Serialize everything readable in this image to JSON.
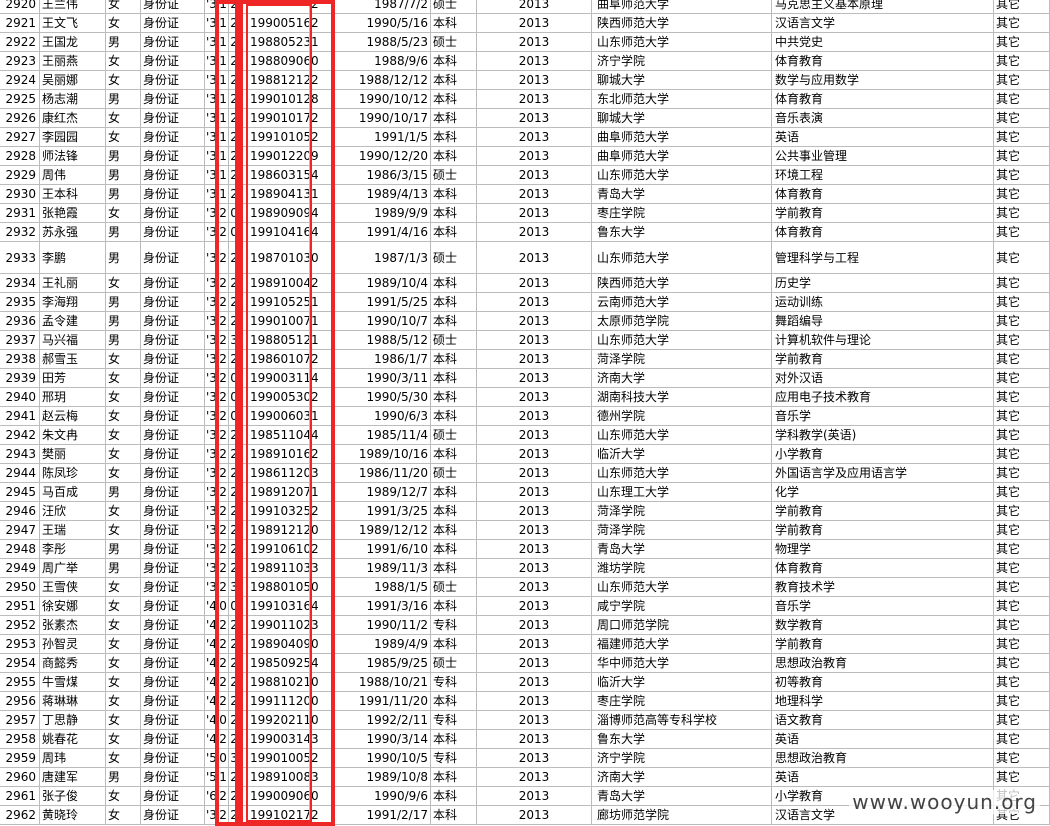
{
  "columns": [
    "no",
    "name",
    "gender",
    "id_type",
    "id1",
    "id2",
    "id3",
    "birth_code",
    "id_tail",
    "birth_date",
    "degree",
    "year",
    "school",
    "major",
    "category"
  ],
  "rows": [
    [
      "2920",
      "王兰伟",
      "女",
      "身份证",
      "'3",
      "1",
      "2",
      "",
      "2",
      "1987/7/2",
      "硕士",
      "2013",
      "曲阜师范大学",
      "马克思主义基本原理",
      "其它"
    ],
    [
      "2921",
      "王文飞",
      "女",
      "身份证",
      "'3",
      "1",
      "2",
      "19900516",
      "2",
      "1990/5/16",
      "本科",
      "2013",
      "陕西师范大学",
      "汉语言文学",
      "其它"
    ],
    [
      "2922",
      "王国龙",
      "男",
      "身份证",
      "'3",
      "1",
      "2",
      "19880523",
      "1",
      "1988/5/23",
      "硕士",
      "2013",
      "山东师范大学",
      "中共党史",
      "其它"
    ],
    [
      "2923",
      "王丽燕",
      "女",
      "身份证",
      "'3",
      "1",
      "2",
      "19880906",
      "0",
      "1988/9/6",
      "本科",
      "2013",
      "济宁学院",
      "体育教育",
      "其它"
    ],
    [
      "2924",
      "吴丽娜",
      "女",
      "身份证",
      "'3",
      "1",
      "2",
      "19881212",
      "2",
      "1988/12/12",
      "本科",
      "2013",
      "聊城大学",
      "数学与应用数学",
      "其它"
    ],
    [
      "2925",
      "杨志潮",
      "男",
      "身份证",
      "'3",
      "1",
      "2",
      "19901012",
      "8",
      "1990/10/12",
      "本科",
      "2013",
      "东北师范大学",
      "体育教育",
      "其它"
    ],
    [
      "2926",
      "康红杰",
      "女",
      "身份证",
      "'3",
      "1",
      "2",
      "19901017",
      "2",
      "1990/10/17",
      "本科",
      "2013",
      "聊城大学",
      "音乐表演",
      "其它"
    ],
    [
      "2927",
      "李园园",
      "女",
      "身份证",
      "'3",
      "1",
      "2",
      "19910105",
      "2",
      "1991/1/5",
      "本科",
      "2013",
      "曲阜师范大学",
      "英语",
      "其它"
    ],
    [
      "2928",
      "师法锋",
      "男",
      "身份证",
      "'3",
      "1",
      "2",
      "19901220",
      "9",
      "1990/12/20",
      "本科",
      "2013",
      "曲阜师范大学",
      "公共事业管理",
      "其它"
    ],
    [
      "2929",
      "周伟",
      "男",
      "身份证",
      "'3",
      "1",
      "2",
      "19860315",
      "4",
      "1986/3/15",
      "硕士",
      "2013",
      "山东师范大学",
      "环境工程",
      "其它"
    ],
    [
      "2930",
      "王本科",
      "男",
      "身份证",
      "'3",
      "1",
      "2",
      "19890413",
      "1",
      "1989/4/13",
      "本科",
      "2013",
      "青岛大学",
      "体育教育",
      "其它"
    ],
    [
      "2931",
      "张艳霞",
      "女",
      "身份证",
      "'3",
      "2",
      "0",
      "19890909",
      "4",
      "1989/9/9",
      "本科",
      "2013",
      "枣庄学院",
      "学前教育",
      "其它"
    ],
    [
      "2932",
      "苏永强",
      "男",
      "身份证",
      "'3",
      "2",
      "0",
      "19910416",
      "4",
      "1991/4/16",
      "本科",
      "2013",
      "鲁东大学",
      "体育教育",
      "其它"
    ],
    [
      "2933",
      "李鹏",
      "男",
      "身份证",
      "'3",
      "2",
      "2",
      "19870103",
      "0",
      "1987/1/3",
      "硕士",
      "2013",
      "山东师范大学",
      "管理科学与工程",
      "其它"
    ],
    [
      "2934",
      "王礼丽",
      "女",
      "身份证",
      "'3",
      "2",
      "2",
      "19891004",
      "2",
      "1989/10/4",
      "本科",
      "2013",
      "陕西师范大学",
      "历史学",
      "其它"
    ],
    [
      "2935",
      "李海翔",
      "男",
      "身份证",
      "'3",
      "2",
      "2",
      "19910525",
      "1",
      "1991/5/25",
      "本科",
      "2013",
      "云南师范大学",
      "运动训练",
      "其它"
    ],
    [
      "2936",
      "孟令建",
      "男",
      "身份证",
      "'3",
      "2",
      "2",
      "19901007",
      "1",
      "1990/10/7",
      "本科",
      "2013",
      "太原师范学院",
      "舞蹈编导",
      "其它"
    ],
    [
      "2937",
      "马兴福",
      "男",
      "身份证",
      "'3",
      "2",
      "3",
      "19880512",
      "1",
      "1988/5/12",
      "硕士",
      "2013",
      "山东师范大学",
      "计算机软件与理论",
      "其它"
    ],
    [
      "2938",
      "郝雪玉",
      "女",
      "身份证",
      "'3",
      "2",
      "2",
      "19860107",
      "2",
      "1986/1/7",
      "本科",
      "2013",
      "菏泽学院",
      "学前教育",
      "其它"
    ],
    [
      "2939",
      "田芳",
      "女",
      "身份证",
      "'3",
      "2",
      "0",
      "19900311",
      "4",
      "1990/3/11",
      "本科",
      "2013",
      "济南大学",
      "对外汉语",
      "其它"
    ],
    [
      "2940",
      "邢玥",
      "女",
      "身份证",
      "'3",
      "2",
      "0",
      "19900530",
      "2",
      "1990/5/30",
      "本科",
      "2013",
      "湖南科技大学",
      "应用电子技术教育",
      "其它"
    ],
    [
      "2941",
      "赵云梅",
      "女",
      "身份证",
      "'3",
      "2",
      "0",
      "19900603",
      "1",
      "1990/6/3",
      "本科",
      "2013",
      "德州学院",
      "音乐学",
      "其它"
    ],
    [
      "2942",
      "朱文冉",
      "女",
      "身份证",
      "'3",
      "2",
      "2",
      "19851104",
      "4",
      "1985/11/4",
      "硕士",
      "2013",
      "山东师范大学",
      "学科教学(英语)",
      "其它"
    ],
    [
      "2943",
      "樊丽",
      "女",
      "身份证",
      "'3",
      "2",
      "2",
      "19891016",
      "2",
      "1989/10/16",
      "本科",
      "2013",
      "临沂大学",
      "小学教育",
      "其它"
    ],
    [
      "2944",
      "陈凤珍",
      "女",
      "身份证",
      "'3",
      "2",
      "2",
      "19861120",
      "3",
      "1986/11/20",
      "硕士",
      "2013",
      "山东师范大学",
      "外国语言学及应用语言学",
      "其它"
    ],
    [
      "2945",
      "马百成",
      "男",
      "身份证",
      "'3",
      "2",
      "2",
      "19891207",
      "1",
      "1989/12/7",
      "本科",
      "2013",
      "山东理工大学",
      "化学",
      "其它"
    ],
    [
      "2946",
      "汪欣",
      "女",
      "身份证",
      "'3",
      "2",
      "2",
      "19910325",
      "2",
      "1991/3/25",
      "本科",
      "2013",
      "菏泽学院",
      "学前教育",
      "其它"
    ],
    [
      "2947",
      "王瑞",
      "女",
      "身份证",
      "'3",
      "2",
      "2",
      "19891212",
      "0",
      "1989/12/12",
      "本科",
      "2013",
      "菏泽学院",
      "学前教育",
      "其它"
    ],
    [
      "2948",
      "李彤",
      "男",
      "身份证",
      "'3",
      "2",
      "2",
      "19910610",
      "2",
      "1991/6/10",
      "本科",
      "2013",
      "青岛大学",
      "物理学",
      "其它"
    ],
    [
      "2949",
      "周广举",
      "男",
      "身份证",
      "'3",
      "2",
      "2",
      "19891103",
      "3",
      "1989/11/3",
      "本科",
      "2013",
      "潍坊学院",
      "体育教育",
      "其它"
    ],
    [
      "2950",
      "王雪侠",
      "女",
      "身份证",
      "'3",
      "2",
      "3",
      "19880105",
      "0",
      "1988/1/5",
      "硕士",
      "2013",
      "山东师范大学",
      "教育技术学",
      "其它"
    ],
    [
      "2951",
      "徐安娜",
      "女",
      "身份证",
      "'4",
      "0",
      "0",
      "19910316",
      "4",
      "1991/3/16",
      "本科",
      "2013",
      "咸宁学院",
      "音乐学",
      "其它"
    ],
    [
      "2952",
      "张素杰",
      "女",
      "身份证",
      "'4",
      "2",
      "2",
      "19901102",
      "3",
      "1990/11/2",
      "专科",
      "2013",
      "周口师范学院",
      "数学教育",
      "其它"
    ],
    [
      "2953",
      "孙智灵",
      "女",
      "身份证",
      "'4",
      "2",
      "2",
      "19890409",
      "0",
      "1989/4/9",
      "本科",
      "2013",
      "福建师范大学",
      "学前教育",
      "其它"
    ],
    [
      "2954",
      "商懿秀",
      "女",
      "身份证",
      "'4",
      "2",
      "2",
      "19850925",
      "4",
      "1985/9/25",
      "硕士",
      "2013",
      "华中师范大学",
      "思想政治教育",
      "其它"
    ],
    [
      "2955",
      "牛雪煤",
      "女",
      "身份证",
      "'4",
      "2",
      "2",
      "19881021",
      "0",
      "1988/10/21",
      "专科",
      "2013",
      "临沂大学",
      "初等教育",
      "其它"
    ],
    [
      "2956",
      "蒋琳琳",
      "女",
      "身份证",
      "'4",
      "2",
      "2",
      "19911120",
      "0",
      "1991/11/20",
      "本科",
      "2013",
      "枣庄学院",
      "地理科学",
      "其它"
    ],
    [
      "2957",
      "丁思静",
      "女",
      "身份证",
      "'4",
      "0",
      "2",
      "19920211",
      "0",
      "1992/2/11",
      "专科",
      "2013",
      "淄博师范高等专科学校",
      "语文教育",
      "其它"
    ],
    [
      "2958",
      "姚春花",
      "女",
      "身份证",
      "'4",
      "2",
      "2",
      "19900314",
      "3",
      "1990/3/14",
      "本科",
      "2013",
      "鲁东大学",
      "英语",
      "其它"
    ],
    [
      "2959",
      "周玮",
      "女",
      "身份证",
      "'5",
      "0",
      "3",
      "19901005",
      "2",
      "1990/10/5",
      "专科",
      "2013",
      "济宁学院",
      "思想政治教育",
      "其它"
    ],
    [
      "2960",
      "唐建军",
      "男",
      "身份证",
      "'5",
      "1",
      "2",
      "19891008",
      "3",
      "1989/10/8",
      "本科",
      "2013",
      "济南大学",
      "英语",
      "其它"
    ],
    [
      "2961",
      "张子俊",
      "女",
      "身份证",
      "'6",
      "2",
      "2",
      "19900906",
      "0",
      "1990/9/6",
      "本科",
      "2013",
      "青岛大学",
      "小学教育",
      "其它"
    ],
    [
      "2962",
      "黄晓玲",
      "女",
      "身份证",
      "'3",
      "2",
      "2",
      "19910217",
      "2",
      "1991/2/17",
      "本科",
      "2013",
      "廊坊师范学院",
      "汉语言文学",
      "其它"
    ]
  ],
  "watermark": "www.wooyun.org",
  "colors": {
    "highlight_border": "#ee2626",
    "grid": "#bcbcbc"
  }
}
